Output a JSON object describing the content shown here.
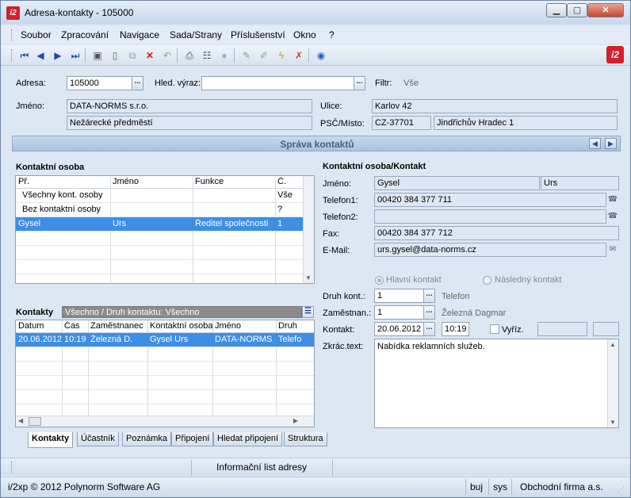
{
  "window": {
    "title": "Adresa-kontakty - 105000"
  },
  "menu": [
    "Soubor",
    "Zpracování",
    "Navigace",
    "Sada/Strany",
    "Příslušenství",
    "Okno",
    "?"
  ],
  "address": {
    "adresa_label": "Adresa:",
    "adresa_value": "105000",
    "hled_label": "Hled. výraz:",
    "hled_value": "",
    "filtr_label": "Filtr:",
    "filtr_value": "Vše",
    "jmeno_label": "Jméno:",
    "jmeno_value": "DATA-NORMS s.r.o.",
    "jmeno_value2": "Nežárecké předměstí",
    "ulice_label": "Ulice:",
    "ulice_value": "Karlov 42",
    "psc_label": "PSČ/Místo:",
    "psc_value": "CZ-37701",
    "misto_value": "Jindřichův Hradec 1"
  },
  "section": {
    "title": "Správa kontaktů"
  },
  "persons": {
    "title": "Kontaktní osoba",
    "columns": [
      "Př.",
      "Jméno",
      "Funkce",
      "Č."
    ],
    "rows": [
      {
        "prijmeni": "Všechny kont. osoby",
        "jmeno": "",
        "funkce": "",
        "c": "Vše"
      },
      {
        "prijmeni": "Bez kontaktní osoby",
        "jmeno": "",
        "funkce": "",
        "c": "?"
      },
      {
        "prijmeni": "Gysel",
        "jmeno": "Urs",
        "funkce": "Ředitel společnosti",
        "c": "1"
      }
    ]
  },
  "contacts": {
    "title": "Kontakty",
    "filter": "Všechno / Druh kontaktu: Všechno",
    "columns": [
      "Datum",
      "Čas",
      "Zaměstnanec",
      "Kontaktní osoba",
      "Jméno",
      "Druh"
    ],
    "rows": [
      {
        "datum": "20.06.2012",
        "cas": "10:19",
        "zamestnanec": "Železná D.",
        "osoba": "Gysel Urs",
        "jmeno": "DATA-NORMS",
        "druh": "Telefo"
      }
    ]
  },
  "detail": {
    "title": "Kontaktní osoba/Kontakt",
    "jmeno_label": "Jméno:",
    "prijmeni": "Gysel",
    "krestni": "Urs",
    "tel1_label": "Telefon1:",
    "tel1": "00420 384 377 711",
    "tel2_label": "Telefon2:",
    "tel2": "",
    "fax_label": "Fax:",
    "fax": "00420 384 377 712",
    "email_label": "E-Mail:",
    "email": "urs.gysel@data-norms.cz",
    "hlavni_label": "Hlavní kontakt",
    "nasledny_label": "Následný kontakt",
    "druh_label": "Druh kont.:",
    "druh_value": "1",
    "druh_text": "Telefon",
    "zam_label": "Zaměstnan.:",
    "zam_value": "1",
    "zam_text": "Železná Dagmar",
    "kontakt_label": "Kontakt:",
    "kontakt_date": "20.06.2012",
    "kontakt_time": "10:19",
    "vyriz_label": "Vyříz.",
    "zkrac_label": "Zkrác.text:",
    "zkrac_value": "Nabídka reklamních služeb."
  },
  "tabs": [
    "Kontakty",
    "Účastník",
    "Poznámka",
    "Připojení",
    "Hledat připojení",
    "Struktura"
  ],
  "infobar": {
    "label": "Informační list adresy"
  },
  "status": {
    "copyright": "i/2xp © 2012 Polynorm Software AG",
    "user": "buj",
    "db": "sys",
    "firm": "Obchodní firma a.s."
  }
}
